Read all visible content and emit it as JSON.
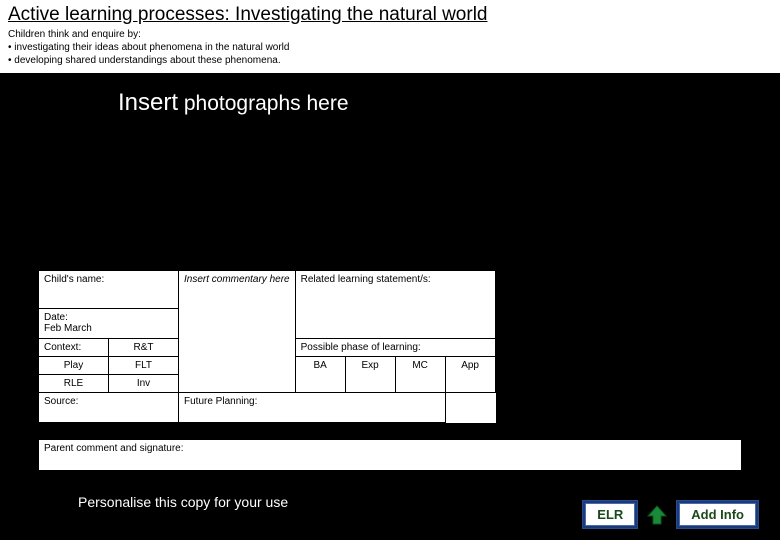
{
  "header": {
    "title": "Active learning processes: Investigating the natural world",
    "subtitle": "Children think and enquire by:",
    "bullets": [
      "• investigating their ideas about phenomena in the natural world",
      "• developing shared understandings about these phenomena."
    ]
  },
  "photo": {
    "insert": "Insert",
    "rest": " photographs here"
  },
  "form": {
    "child_name_label": "Child's name:",
    "commentary_placeholder": "Insert commentary here",
    "related_label": "Related learning statement/s:",
    "date_label": "Date:",
    "date_value": "Feb March",
    "context_label": "Context:",
    "rt": "R&T",
    "play": "Play",
    "flt": "FLT",
    "rle": "RLE",
    "inv": "Inv",
    "possible_phase_label": "Possible phase of learning:",
    "ba": "BA",
    "exp": "Exp",
    "mc": "MC",
    "app": "App",
    "source_label": "Source:",
    "future_label": "Future Planning:",
    "parent_label": "Parent comment and signature:"
  },
  "footer": {
    "personalise": "Personalise this copy for your use",
    "elr": "ELR",
    "add_info": "Add Info"
  }
}
